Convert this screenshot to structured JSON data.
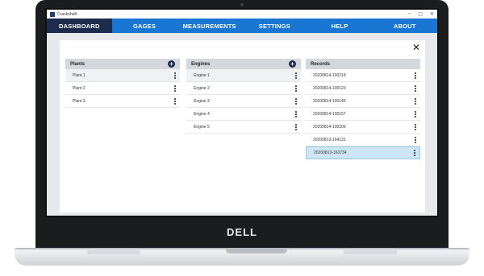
{
  "device": {
    "brand": "DELL"
  },
  "window": {
    "title": "Crankshaft",
    "controls": [
      "–",
      "▢",
      "✕"
    ]
  },
  "nav": {
    "items": [
      {
        "label": "DASHBOARD",
        "active": true
      },
      {
        "label": "GAGES"
      },
      {
        "label": "MEASUREMENTS"
      },
      {
        "label": "SETTINGS"
      },
      {
        "label": "HELP"
      },
      {
        "label": "ABOUT"
      }
    ]
  },
  "panel": {
    "close_icon": "close-icon"
  },
  "plants": {
    "header": "Plants",
    "add_icon": "+",
    "items": [
      "Plant 1",
      "Plant 2",
      "Plant 3"
    ]
  },
  "engines": {
    "header": "Engines",
    "add_icon": "+",
    "items": [
      "Engine 1",
      "Engine 2",
      "Engine 3",
      "Engine 4",
      "Engine 5"
    ]
  },
  "records": {
    "header": "Records",
    "items": [
      "20200814-100218",
      "20200814-100123",
      "20200814-100145",
      "20200814-100157",
      "20200814-100206",
      "20200813-164131",
      "20200813-163734"
    ],
    "selected_index": 6
  },
  "colors": {
    "nav_bg": "#1976d2",
    "nav_active": "#1d2b4d",
    "selected_row": "#cde6f3"
  }
}
